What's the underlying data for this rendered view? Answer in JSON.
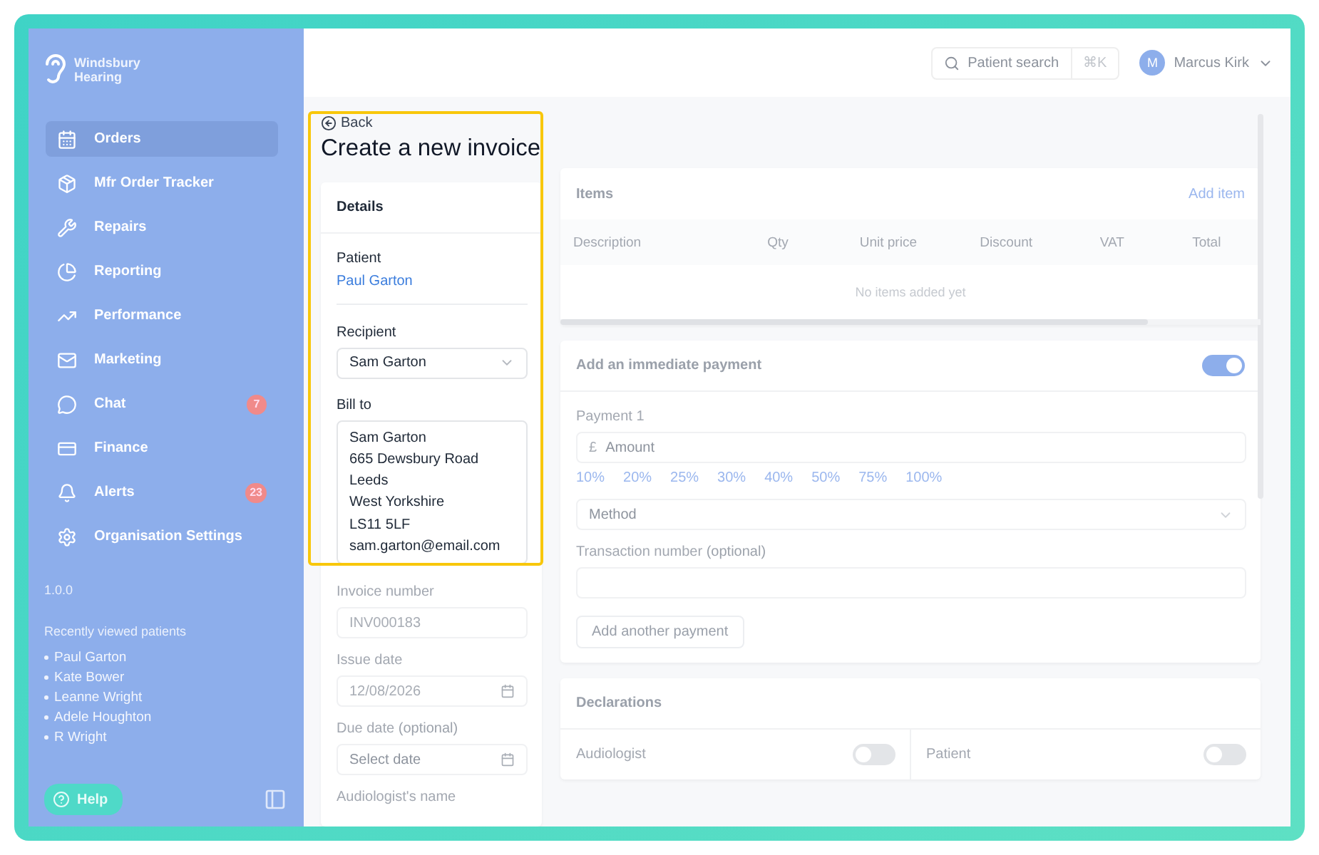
{
  "sidebar": {
    "brand": [
      "Windsbury",
      "Hearing"
    ],
    "items": [
      {
        "kind": "orders",
        "label": "Orders",
        "selected": true
      },
      {
        "kind": "tracker",
        "label": "Mfr Order Tracker",
        "selected": false
      },
      {
        "kind": "repairs",
        "label": "Repairs",
        "selected": false
      },
      {
        "kind": "reporting",
        "label": "Reporting",
        "selected": false
      },
      {
        "kind": "performance",
        "label": "Performance",
        "selected": false
      },
      {
        "kind": "marketing",
        "label": "Marketing",
        "selected": false
      },
      {
        "kind": "chat",
        "label": "Chat",
        "selected": false,
        "badge": "7"
      },
      {
        "kind": "finance",
        "label": "Finance",
        "selected": false
      },
      {
        "kind": "alerts",
        "label": "Alerts",
        "selected": false,
        "badge": "23"
      },
      {
        "kind": "settings",
        "label": "Organisation Settings",
        "selected": false
      }
    ],
    "version": "1.0.0",
    "recent_title": "Recently viewed patients",
    "recent": [
      "Paul Garton",
      "Kate Bower",
      "Leanne Wright",
      "Adele Houghton",
      "R Wright"
    ],
    "help": "Help"
  },
  "header": {
    "search": {
      "placeholder": "Patient search",
      "shortcut": "⌘K"
    },
    "user": {
      "initial": "M",
      "name": "Marcus Kirk"
    }
  },
  "page": {
    "back": "Back",
    "title": "Create a new invoice",
    "highlighted": true
  },
  "details": {
    "title": "Details",
    "patient_label": "Patient",
    "patient": "Paul Garton",
    "recipient_label": "Recipient",
    "recipient": "Sam Garton",
    "bill_to_label": "Bill to",
    "bill_to": [
      "Sam Garton",
      "665 Dewsbury Road",
      "Leeds",
      "West Yorkshire",
      "LS11 5LF",
      "sam.garton@email.com"
    ],
    "invoice_number_label": "Invoice number",
    "invoice_number": "INV000183",
    "issue_date_label": "Issue date",
    "issue_date": "12/08/2026",
    "due_date_label": "Due date",
    "due_date_note": "(optional)",
    "due_date_placeholder": "Select date",
    "audiologist_label": "Audiologist's name"
  },
  "items": {
    "title": "Items",
    "add": "Add item",
    "columns": [
      "Description",
      "Qty",
      "Unit price",
      "Discount",
      "VAT",
      "Total"
    ],
    "empty": "No items added yet"
  },
  "payment": {
    "title": "Add an immediate payment",
    "on": true,
    "payment_label": "Payment 1",
    "currency": "£",
    "amount_placeholder": "Amount",
    "percents": [
      "10%",
      "20%",
      "25%",
      "30%",
      "40%",
      "50%",
      "75%",
      "100%"
    ],
    "method_placeholder": "Method",
    "transaction_label": "Transaction number",
    "transaction_note": "(optional)",
    "add_another": "Add another payment"
  },
  "declarations": {
    "title": "Declarations",
    "toggles": [
      {
        "label": "Audiologist",
        "on": false
      },
      {
        "label": "Patient",
        "on": false
      }
    ]
  }
}
